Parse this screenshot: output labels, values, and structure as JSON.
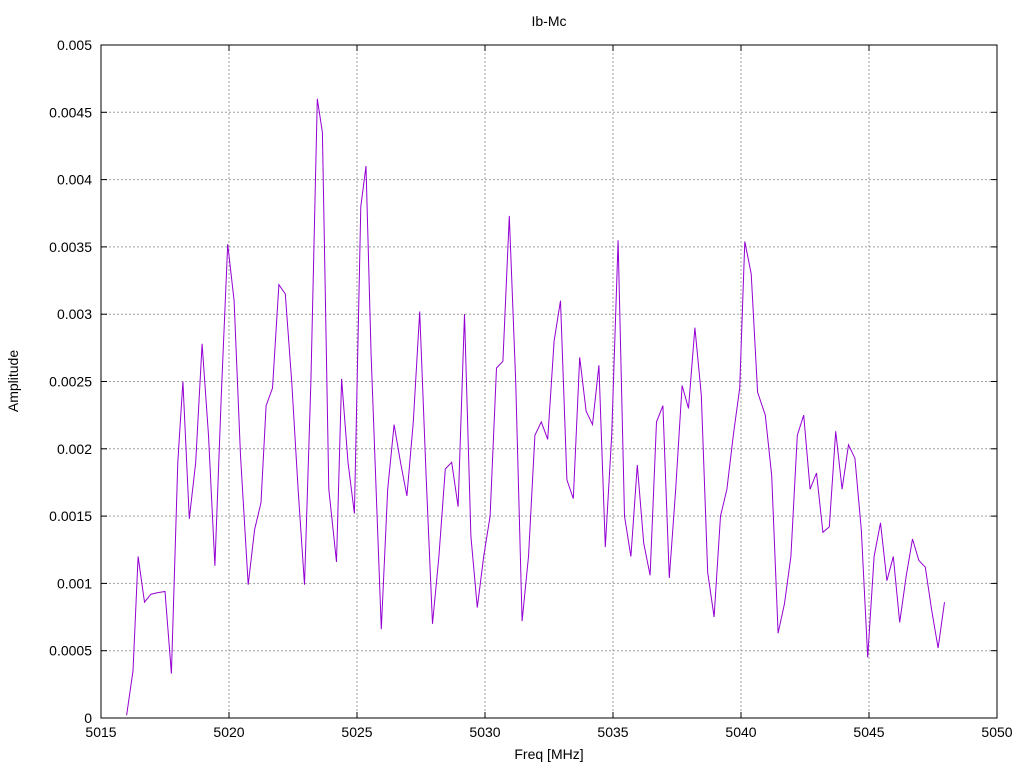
{
  "chart_data": {
    "type": "line",
    "title": "Ib-Mc",
    "xlabel": "Freq [MHz]",
    "ylabel": "Amplitude",
    "xlim": [
      5015,
      5050
    ],
    "ylim": [
      0,
      0.005
    ],
    "x_ticks": [
      5015,
      5020,
      5025,
      5030,
      5035,
      5040,
      5045,
      5050
    ],
    "y_ticks": [
      0,
      0.0005,
      0.001,
      0.0015,
      0.002,
      0.0025,
      0.003,
      0.0035,
      0.004,
      0.0045,
      0.005
    ],
    "grid": true,
    "series": [
      {
        "color": "#9400d3",
        "points": [
          [
            5016.0,
            2e-05
          ],
          [
            5016.25,
            0.00035
          ],
          [
            5016.45,
            0.0012
          ],
          [
            5016.7,
            0.00086
          ],
          [
            5016.95,
            0.00092
          ],
          [
            5017.2,
            0.00093
          ],
          [
            5017.5,
            0.00094
          ],
          [
            5017.75,
            0.00033
          ],
          [
            5018.0,
            0.0019
          ],
          [
            5018.2,
            0.0025
          ],
          [
            5018.45,
            0.00148
          ],
          [
            5018.7,
            0.0019
          ],
          [
            5018.95,
            0.00278
          ],
          [
            5019.2,
            0.0021
          ],
          [
            5019.45,
            0.00113
          ],
          [
            5019.7,
            0.0024
          ],
          [
            5019.95,
            0.00352
          ],
          [
            5020.2,
            0.0031
          ],
          [
            5020.45,
            0.00195
          ],
          [
            5020.75,
            0.00099
          ],
          [
            5021.0,
            0.0014
          ],
          [
            5021.25,
            0.0016
          ],
          [
            5021.45,
            0.00232
          ],
          [
            5021.7,
            0.00245
          ],
          [
            5021.95,
            0.00322
          ],
          [
            5022.2,
            0.00315
          ],
          [
            5022.45,
            0.0025
          ],
          [
            5022.7,
            0.0017
          ],
          [
            5022.95,
            0.00099
          ],
          [
            5023.2,
            0.0025
          ],
          [
            5023.45,
            0.0046
          ],
          [
            5023.65,
            0.00435
          ],
          [
            5023.9,
            0.0017
          ],
          [
            5024.2,
            0.00116
          ],
          [
            5024.4,
            0.00252
          ],
          [
            5024.65,
            0.0019
          ],
          [
            5024.9,
            0.00152
          ],
          [
            5025.15,
            0.0038
          ],
          [
            5025.35,
            0.0041
          ],
          [
            5025.55,
            0.0027
          ],
          [
            5025.95,
            0.00066
          ],
          [
            5026.2,
            0.0017
          ],
          [
            5026.45,
            0.00218
          ],
          [
            5026.7,
            0.0019
          ],
          [
            5026.95,
            0.00165
          ],
          [
            5027.2,
            0.0022
          ],
          [
            5027.45,
            0.00302
          ],
          [
            5027.7,
            0.0018
          ],
          [
            5027.95,
            0.0007
          ],
          [
            5028.2,
            0.0012
          ],
          [
            5028.45,
            0.00185
          ],
          [
            5028.7,
            0.0019
          ],
          [
            5028.95,
            0.00157
          ],
          [
            5029.2,
            0.003
          ],
          [
            5029.45,
            0.00135
          ],
          [
            5029.7,
            0.00082
          ],
          [
            5029.95,
            0.0012
          ],
          [
            5030.2,
            0.0015
          ],
          [
            5030.45,
            0.0026
          ],
          [
            5030.7,
            0.00265
          ],
          [
            5030.95,
            0.00373
          ],
          [
            5031.2,
            0.0025
          ],
          [
            5031.45,
            0.00072
          ],
          [
            5031.7,
            0.0012
          ],
          [
            5031.95,
            0.0021
          ],
          [
            5032.2,
            0.0022
          ],
          [
            5032.45,
            0.00207
          ],
          [
            5032.7,
            0.0028
          ],
          [
            5032.95,
            0.0031
          ],
          [
            5033.2,
            0.00177
          ],
          [
            5033.45,
            0.00163
          ],
          [
            5033.7,
            0.00268
          ],
          [
            5033.95,
            0.00228
          ],
          [
            5034.2,
            0.00218
          ],
          [
            5034.45,
            0.00262
          ],
          [
            5034.7,
            0.00127
          ],
          [
            5034.95,
            0.0021
          ],
          [
            5035.2,
            0.00355
          ],
          [
            5035.45,
            0.0015
          ],
          [
            5035.7,
            0.0012
          ],
          [
            5035.95,
            0.00188
          ],
          [
            5036.2,
            0.0013
          ],
          [
            5036.45,
            0.00106
          ],
          [
            5036.7,
            0.0022
          ],
          [
            5036.95,
            0.00232
          ],
          [
            5037.2,
            0.00104
          ],
          [
            5037.45,
            0.0017
          ],
          [
            5037.7,
            0.00247
          ],
          [
            5037.95,
            0.0023
          ],
          [
            5038.2,
            0.0029
          ],
          [
            5038.45,
            0.0024
          ],
          [
            5038.7,
            0.00108
          ],
          [
            5038.95,
            0.00075
          ],
          [
            5039.2,
            0.0015
          ],
          [
            5039.45,
            0.0017
          ],
          [
            5039.7,
            0.0021
          ],
          [
            5039.95,
            0.00245
          ],
          [
            5040.15,
            0.00354
          ],
          [
            5040.4,
            0.0033
          ],
          [
            5040.65,
            0.00242
          ],
          [
            5040.95,
            0.00225
          ],
          [
            5041.2,
            0.0018
          ],
          [
            5041.45,
            0.00063
          ],
          [
            5041.7,
            0.00085
          ],
          [
            5041.95,
            0.0012
          ],
          [
            5042.2,
            0.0021
          ],
          [
            5042.45,
            0.00225
          ],
          [
            5042.7,
            0.0017
          ],
          [
            5042.95,
            0.00182
          ],
          [
            5043.2,
            0.00138
          ],
          [
            5043.45,
            0.00142
          ],
          [
            5043.7,
            0.00213
          ],
          [
            5043.95,
            0.0017
          ],
          [
            5044.2,
            0.00203
          ],
          [
            5044.45,
            0.00193
          ],
          [
            5044.7,
            0.0014
          ],
          [
            5044.95,
            0.00045
          ],
          [
            5045.2,
            0.0012
          ],
          [
            5045.45,
            0.00145
          ],
          [
            5045.7,
            0.00102
          ],
          [
            5045.95,
            0.0012
          ],
          [
            5046.2,
            0.00071
          ],
          [
            5046.45,
            0.00105
          ],
          [
            5046.7,
            0.00133
          ],
          [
            5046.95,
            0.00117
          ],
          [
            5047.2,
            0.00112
          ],
          [
            5047.45,
            0.0008
          ],
          [
            5047.7,
            0.00052
          ],
          [
            5047.95,
            0.00086
          ]
        ]
      }
    ]
  }
}
